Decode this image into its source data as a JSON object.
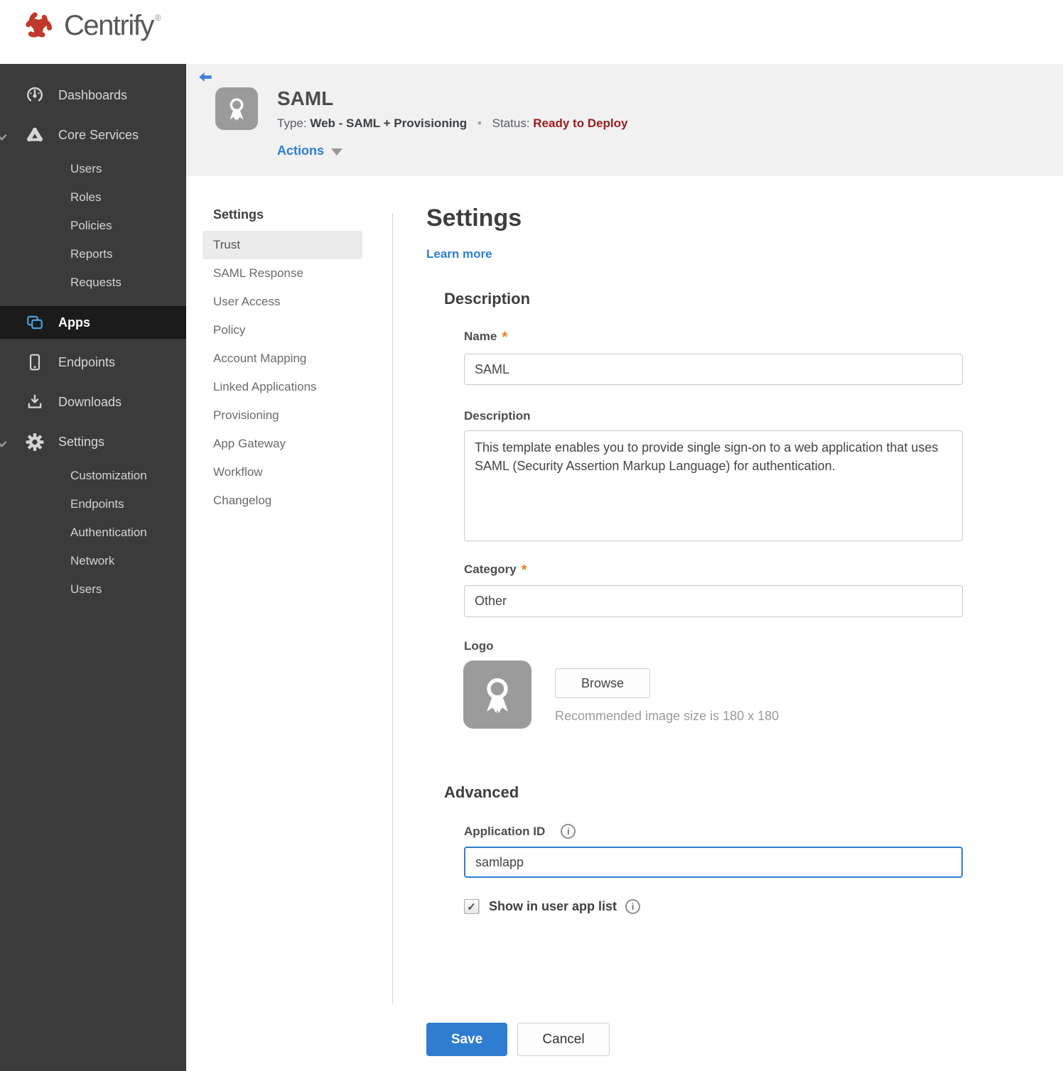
{
  "brand": {
    "name": "Centrify",
    "reg": "®"
  },
  "colors": {
    "accent_blue": "#2e7fd0",
    "save_blue": "#2e7dd1",
    "status_red": "#9c1c1c",
    "brand_red": "#bf392c",
    "asterisk_orange": "#e87c1e",
    "apps_icon_blue": "#4ba0dd",
    "sidebar_bg": "#3b3b3b",
    "sidebar_selected_bg": "#1b1b1b",
    "header_bg": "#f1f1f2"
  },
  "icons": {
    "info_glyph": "i",
    "check_glyph": "✓"
  },
  "sidebar": {
    "items": [
      {
        "label": "Dashboards"
      },
      {
        "label": "Core Services",
        "expanded": true,
        "children": [
          "Users",
          "Roles",
          "Policies",
          "Reports",
          "Requests"
        ]
      },
      {
        "label": "Apps",
        "selected": true
      },
      {
        "label": "Endpoints"
      },
      {
        "label": "Downloads"
      },
      {
        "label": "Settings",
        "expanded": true,
        "children": [
          "Customization",
          "Endpoints",
          "Authentication",
          "Network",
          "Users"
        ]
      }
    ]
  },
  "app_header": {
    "title": "SAML",
    "type_label": "Type:",
    "type_value": "Web - SAML + Provisioning",
    "separator": "•",
    "status_label": "Status:",
    "status_value": "Ready to Deploy",
    "actions_label": "Actions"
  },
  "subnav": {
    "heading": "Settings",
    "selected": "Trust",
    "items": [
      "Trust",
      "SAML Response",
      "User Access",
      "Policy",
      "Account Mapping",
      "Linked Applications",
      "Provisioning",
      "App Gateway",
      "Workflow",
      "Changelog"
    ]
  },
  "main": {
    "heading": "Settings",
    "learn_more": "Learn more",
    "required_marker": "*",
    "sections": {
      "description": "Description",
      "advanced": "Advanced"
    },
    "fields": {
      "name": {
        "label": "Name",
        "value": "SAML",
        "required": true
      },
      "description": {
        "label": "Description",
        "value": "This template enables you to provide single sign-on to a web application that uses SAML (Security Assertion Markup Language) for authentication."
      },
      "category": {
        "label": "Category",
        "value": "Other",
        "required": true
      },
      "logo": {
        "label": "Logo",
        "browse_label": "Browse",
        "hint": "Recommended image size is 180 x 180"
      },
      "application_id": {
        "label": "Application ID",
        "value": "samlapp"
      },
      "show_in_user_app_list": {
        "label": "Show in user app list",
        "checked": true
      }
    },
    "buttons": {
      "save": "Save",
      "cancel": "Cancel"
    }
  }
}
